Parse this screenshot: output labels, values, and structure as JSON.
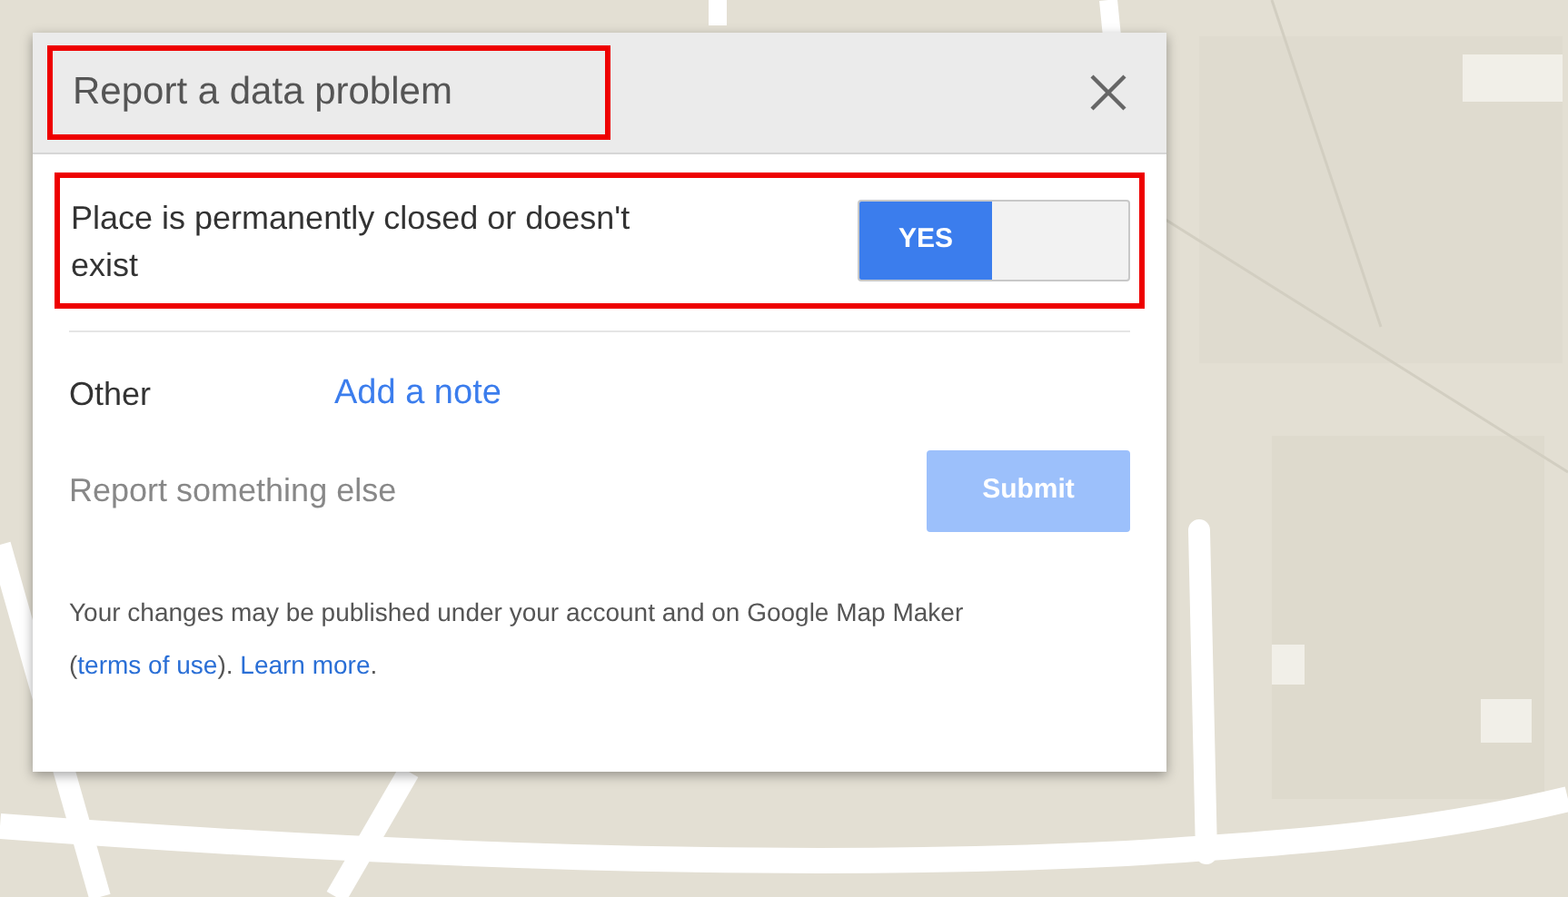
{
  "dialog": {
    "title": "Report a data problem",
    "title_highlighted": true,
    "closed_place": {
      "label": "Place is permanently closed or doesn't exist",
      "toggle_label": "YES",
      "on": true,
      "highlighted": true
    },
    "other": {
      "label": "Other",
      "link": "Add a note"
    },
    "report_else": {
      "label": "Report something else",
      "submit": "Submit",
      "submit_disabled": true
    },
    "footer": {
      "text_before": "Your changes may be published under your account and on Google Map Maker (",
      "terms_link": "terms of use",
      "text_middle": "). ",
      "learn_link": "Learn more",
      "text_after": "."
    }
  }
}
